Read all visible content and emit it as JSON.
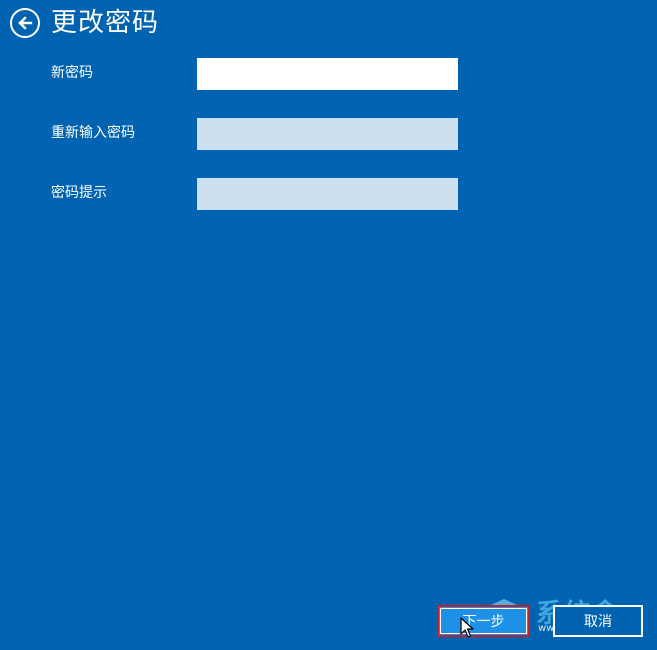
{
  "header": {
    "title": "更改密码",
    "back_icon": "back-arrow-circle-icon"
  },
  "form": {
    "fields": [
      {
        "label": "新密码",
        "value": "",
        "state": "active"
      },
      {
        "label": "重新输入密码",
        "value": "",
        "state": "inactive"
      },
      {
        "label": "密码提示",
        "value": "",
        "state": "inactive"
      }
    ]
  },
  "buttons": {
    "next_label": "下一步",
    "cancel_label": "取消"
  },
  "watermark": {
    "text": "系统盒",
    "url": "www.xitonghe.com"
  },
  "colors": {
    "background": "#0063b1",
    "next_button": "#1e90e6",
    "highlight_border": "#c8201e",
    "inactive_input": "#cce0f0"
  }
}
